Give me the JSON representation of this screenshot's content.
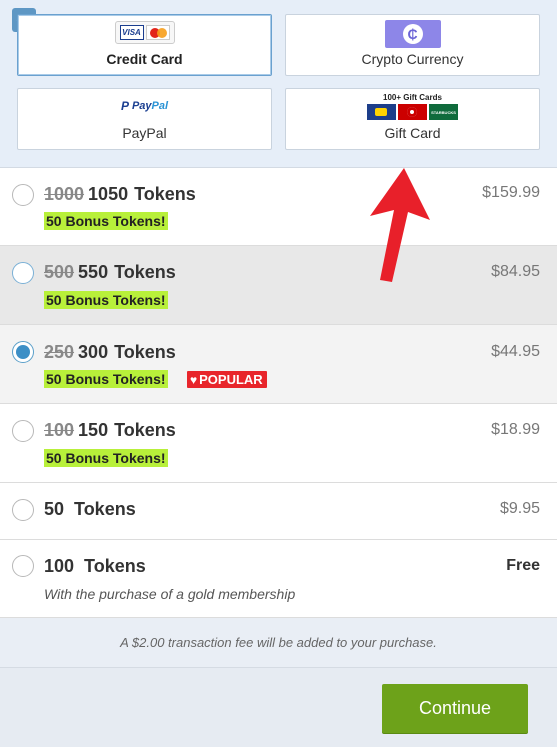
{
  "payment": {
    "methods": [
      {
        "label": "Credit Card",
        "selected": true
      },
      {
        "label": "Crypto Currency",
        "selected": false
      },
      {
        "label": "PayPal",
        "selected": false
      },
      {
        "label": "Gift Card",
        "selected": false
      }
    ],
    "visa_text": "VISA",
    "crypto_symbol": "₵",
    "paypal_p": "P",
    "paypal_pay": "Pay",
    "paypal_pal": "Pal",
    "gift_header": "100+ Gift Cards",
    "gift_starbucks": "STARBUCKS"
  },
  "options": [
    {
      "old": "1000",
      "qty": "1050",
      "unit": "Tokens",
      "bonus": "50 Bonus Tokens!",
      "price": "$159.99",
      "checked": false
    },
    {
      "old": "500",
      "qty": "550",
      "unit": "Tokens",
      "bonus": "50 Bonus Tokens!",
      "price": "$84.95",
      "checked": false
    },
    {
      "old": "250",
      "qty": "300",
      "unit": "Tokens",
      "bonus": "50 Bonus Tokens!",
      "price": "$44.95",
      "checked": true,
      "badge": "POPULAR"
    },
    {
      "old": "100",
      "qty": "150",
      "unit": "Tokens",
      "bonus": "50 Bonus Tokens!",
      "price": "$18.99",
      "checked": false
    },
    {
      "qty": "50",
      "unit": "Tokens",
      "price": "$9.95",
      "checked": false
    },
    {
      "qty": "100",
      "unit": "Tokens",
      "price": "Free",
      "note": "With the purchase of a gold membership",
      "checked": false
    }
  ],
  "fee_notice": "A $2.00 transaction fee will be added to your purchase.",
  "continue_label": "Continue",
  "colors": {
    "accent": "#3d8fc6",
    "bonus_highlight": "#b8f03a",
    "popular_badge": "#e8252b",
    "continue_button": "#6da21a",
    "annotation_arrow": "#e8202a"
  },
  "icons": {
    "check": "checkmark-icon",
    "heart": "heart-icon",
    "arrow": "red-annotation-arrow"
  }
}
